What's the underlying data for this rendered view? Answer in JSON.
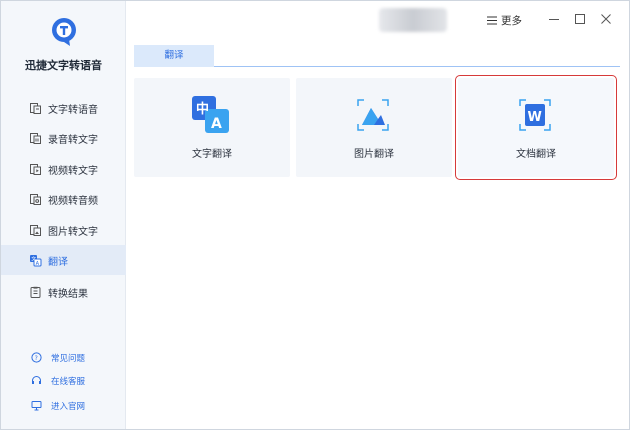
{
  "app": {
    "name": "迅捷文字转语音",
    "brand_color": "#2f6fe0"
  },
  "titlebar": {
    "more_label": "更多"
  },
  "sidebar": {
    "items": [
      {
        "label": "文字转语音",
        "icon": "text-to-speech-icon",
        "active": false
      },
      {
        "label": "录音转文字",
        "icon": "recording-to-text-icon",
        "active": false
      },
      {
        "label": "视频转文字",
        "icon": "video-to-text-icon",
        "active": false
      },
      {
        "label": "视频转音频",
        "icon": "video-to-audio-icon",
        "active": false
      },
      {
        "label": "图片转文字",
        "icon": "image-to-text-icon",
        "active": false
      },
      {
        "label": "翻译",
        "icon": "translate-icon",
        "active": true
      },
      {
        "label": "转换结果",
        "icon": "results-icon",
        "active": false
      }
    ],
    "footer": [
      {
        "label": "常见问题",
        "icon": "question-icon"
      },
      {
        "label": "在线客服",
        "icon": "headset-icon"
      },
      {
        "label": "进入官网",
        "icon": "monitor-icon"
      }
    ]
  },
  "main": {
    "tab_label": "翻译",
    "cards": [
      {
        "label": "文字翻译",
        "icon": "text-translate-icon"
      },
      {
        "label": "图片翻译",
        "icon": "image-translate-icon"
      },
      {
        "label": "文档翻译",
        "icon": "document-translate-icon",
        "selected": true
      }
    ]
  }
}
